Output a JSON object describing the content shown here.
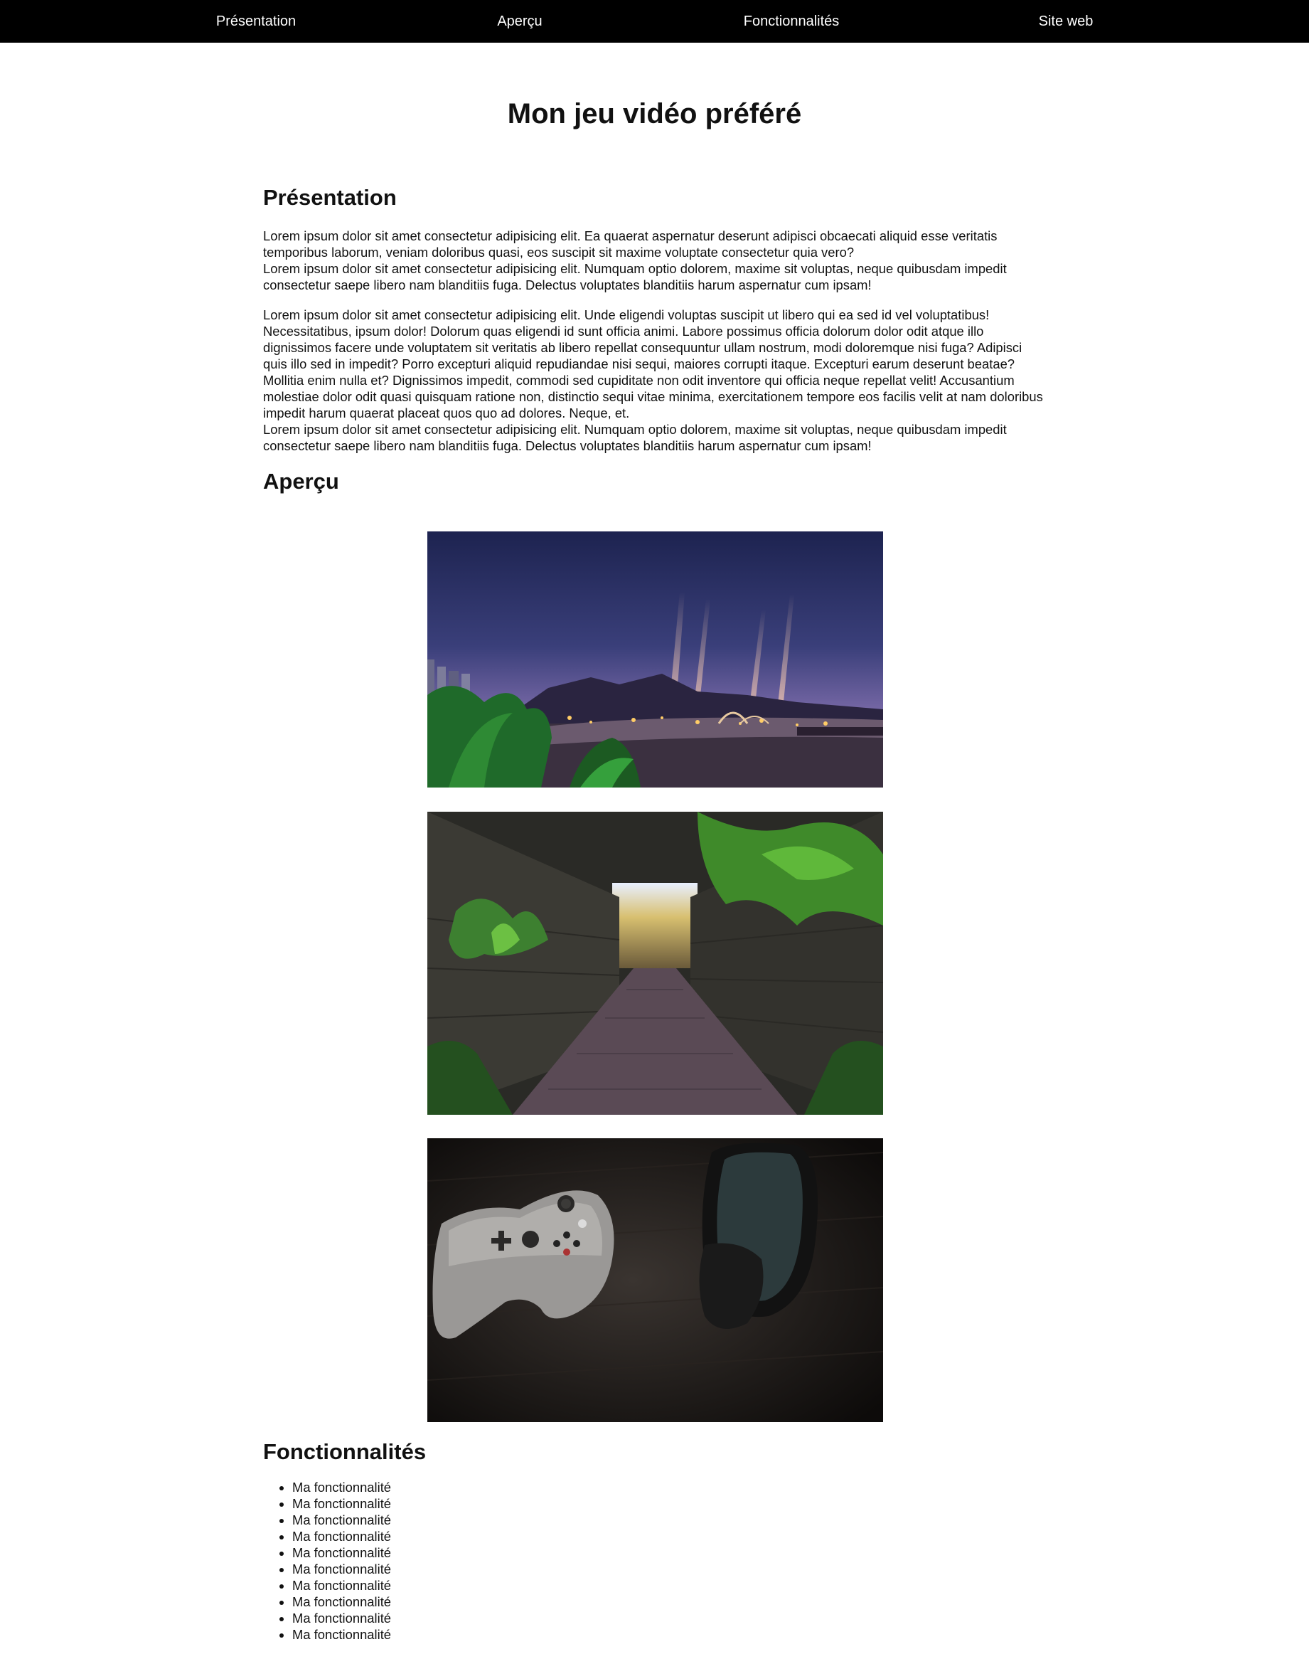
{
  "nav": {
    "items": [
      "Présentation",
      "Aperçu",
      "Fonctionnalités",
      "Site web"
    ]
  },
  "page_title": "Mon jeu vidéo préféré",
  "presentation": {
    "heading": "Présentation",
    "paragraphs": [
      {
        "line1": "Lorem ipsum dolor sit amet consectetur adipisicing elit. Ea quaerat aspernatur deserunt adipisci obcaecati aliquid esse veritatis temporibus laborum, veniam doloribus quasi, eos suscipit sit maxime voluptate consectetur quia vero?",
        "line2": "Lorem ipsum dolor sit amet consectetur adipisicing elit. Numquam optio dolorem, maxime sit voluptas, neque quibusdam impedit consectetur saepe libero nam blanditiis fuga. Delectus voluptates blanditiis harum aspernatur cum ipsam!"
      },
      {
        "line1": "Lorem ipsum dolor sit amet consectetur adipisicing elit. Unde eligendi voluptas suscipit ut libero qui ea sed id vel voluptatibus! Necessitatibus, ipsum dolor! Dolorum quas eligendi id sunt officia animi. Labore possimus officia dolorum dolor odit atque illo dignissimos facere unde voluptatem sit veritatis ab libero repellat consequuntur ullam nostrum, modi doloremque nisi fuga? Adipisci quis illo sed in impedit? Porro excepturi aliquid repudiandae nisi sequi, maiores corrupti itaque. Excepturi earum deserunt beatae? Mollitia enim nulla et? Dignissimos impedit, commodi sed cupiditate non odit inventore qui officia neque repellat velit! Accusantium molestiae dolor odit quasi quisquam ratione non, distinctio sequi vitae minima, exercitationem tempore eos facilis velit at nam doloribus impedit harum quaerat placeat quos quo ad dolores. Neque, et.",
        "line2": "Lorem ipsum dolor sit amet consectetur adipisicing elit. Numquam optio dolorem, maxime sit voluptas, neque quibusdam impedit consectetur saepe libero nam blanditiis fuga. Delectus voluptates blanditiis harum aspernatur cum ipsam!"
      }
    ]
  },
  "apercu": {
    "heading": "Aperçu",
    "images": [
      "night-amusement-park-scene",
      "jungle-alley-scene",
      "game-controller-and-phone-scene"
    ]
  },
  "fonctionnalites": {
    "heading": "Fonctionnalités",
    "items": [
      "Ma fonctionnalité",
      "Ma fonctionnalité",
      "Ma fonctionnalité",
      "Ma fonctionnalité",
      "Ma fonctionnalité",
      "Ma fonctionnalité",
      "Ma fonctionnalité",
      "Ma fonctionnalité",
      "Ma fonctionnalité",
      "Ma fonctionnalité"
    ]
  },
  "colors": {
    "navbar": "#000000",
    "nav_text": "#ffffff",
    "text": "#111111",
    "background": "#ffffff"
  }
}
